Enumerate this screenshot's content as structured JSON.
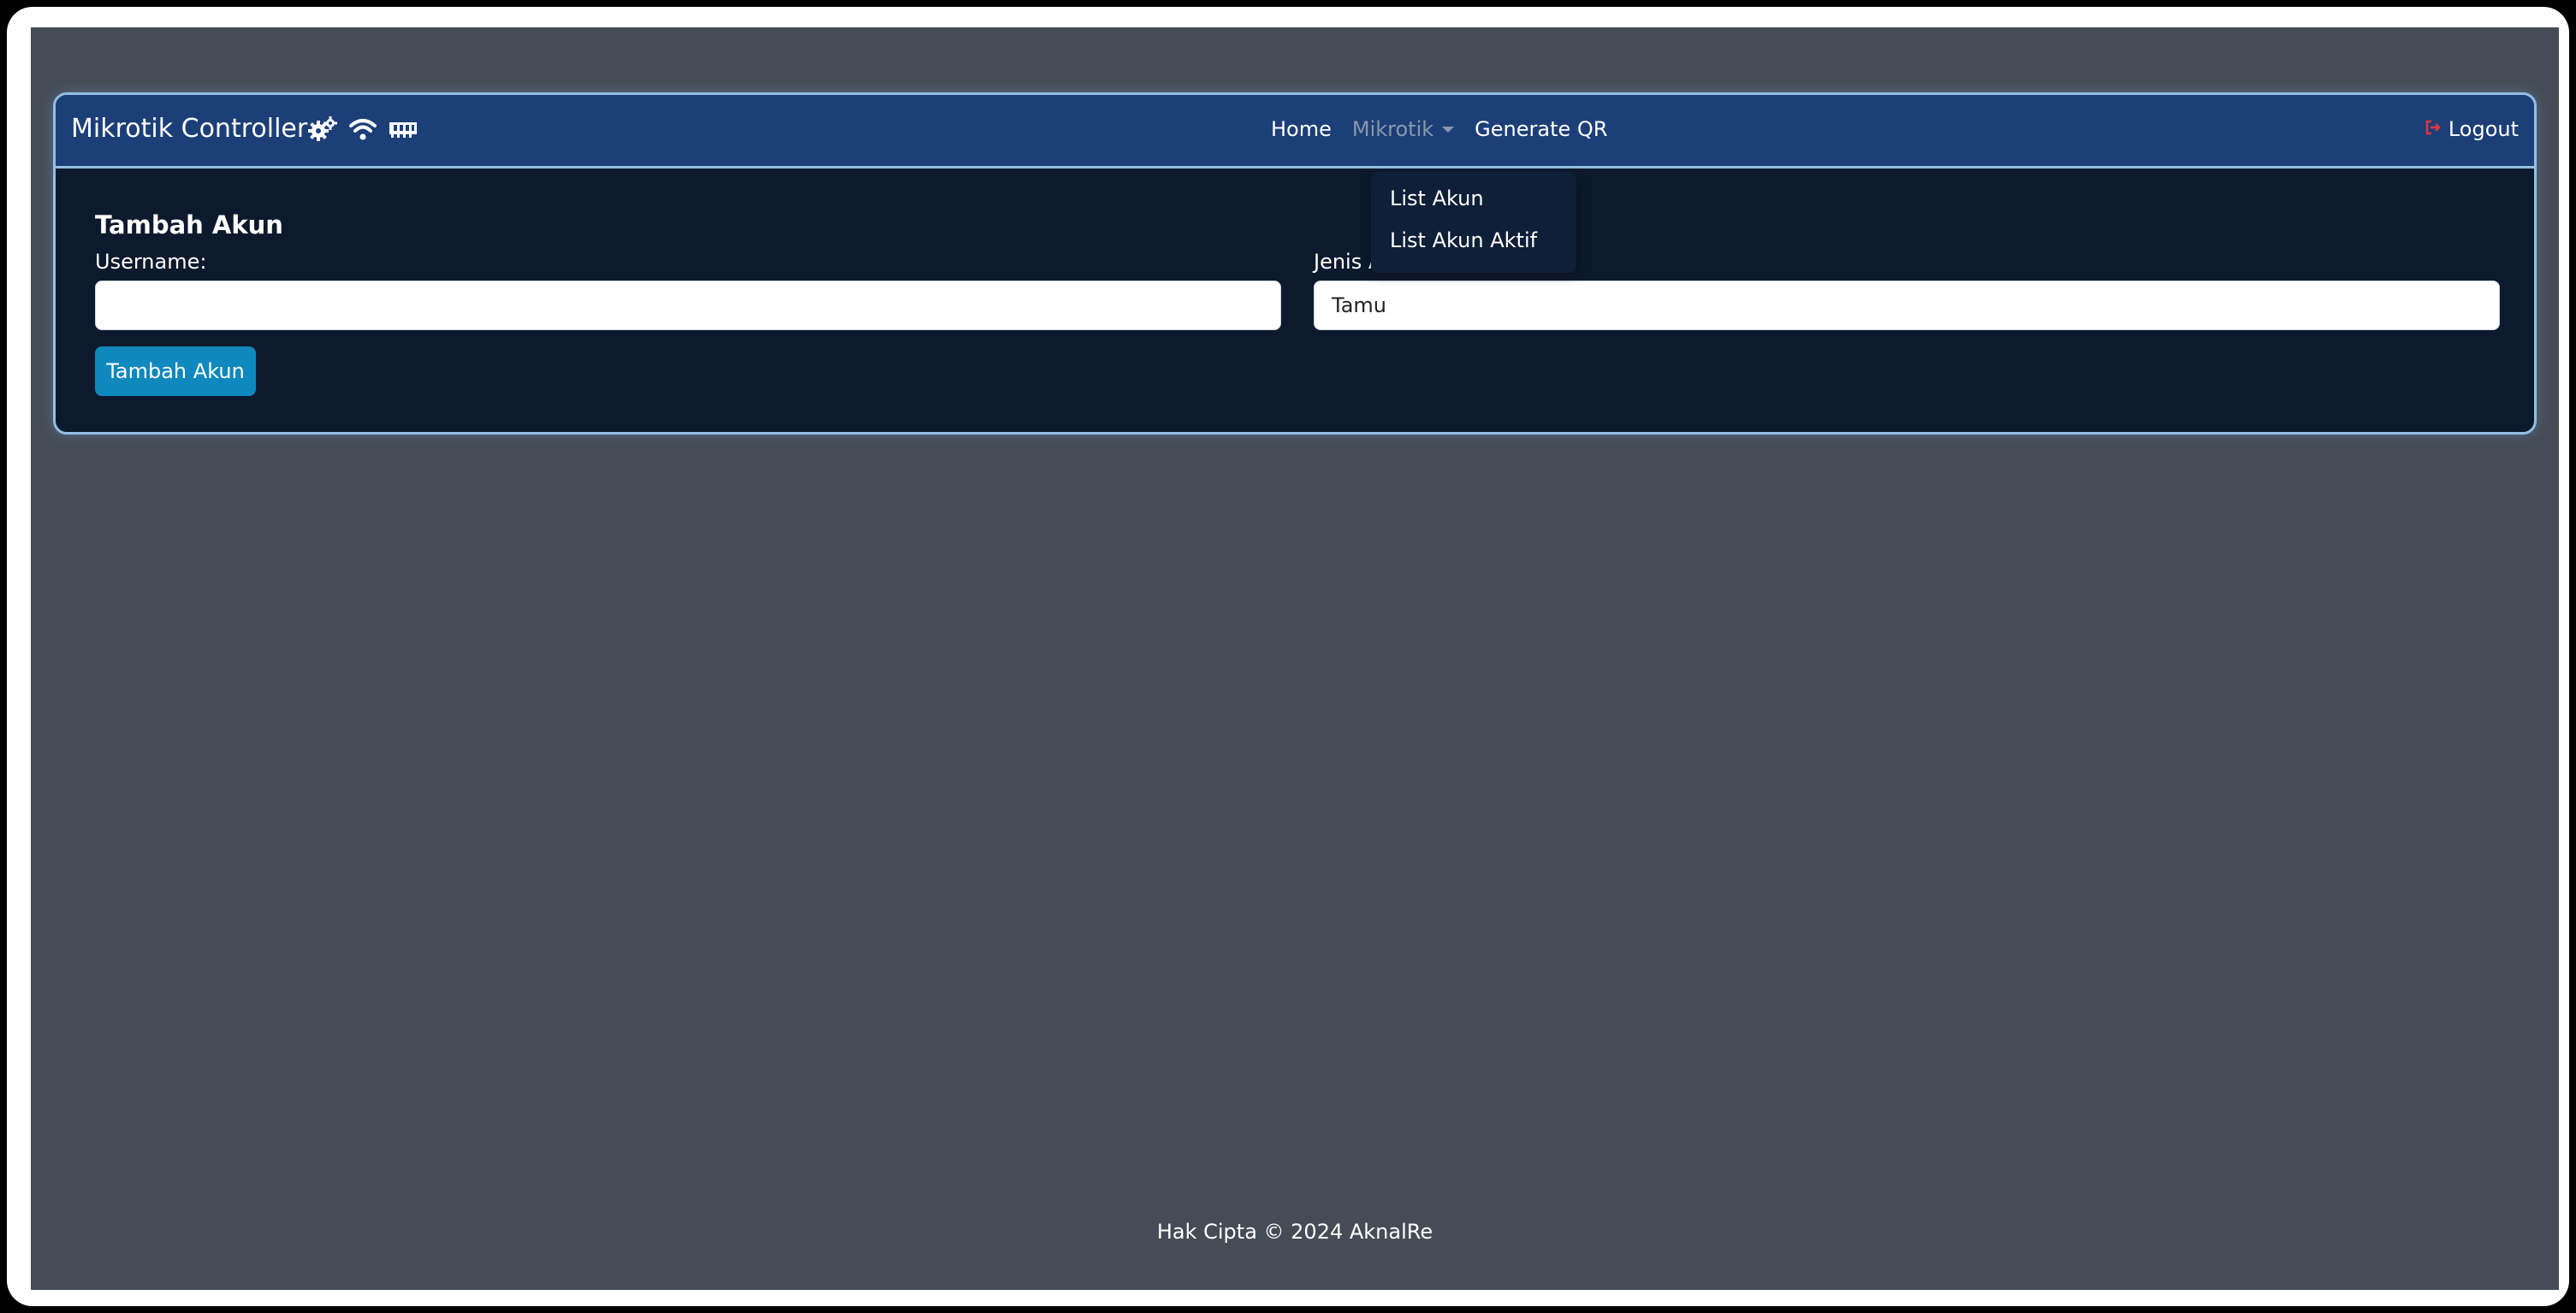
{
  "brand": {
    "title": "Mikrotik Controller",
    "icons": [
      "cogs-icon",
      "wifi-icon",
      "memory-icon"
    ]
  },
  "nav": {
    "home": "Home",
    "mikrotik": "Mikrotik",
    "generate_qr": "Generate QR",
    "logout": "Logout"
  },
  "dropdown": {
    "items": [
      {
        "label": "List Akun"
      },
      {
        "label": "List Akun Aktif"
      }
    ]
  },
  "form": {
    "title": "Tambah Akun",
    "username_label": "Username:",
    "username_value": "",
    "jenis_label": "Jenis Akun:",
    "jenis_value": "Tamu",
    "submit_label": "Tambah Akun"
  },
  "footer": {
    "text": "Hak Cipta © 2024 AknalRe"
  },
  "colors": {
    "navbar": "#1c3f78",
    "card": "#0d1a2d",
    "page": "#454c56",
    "button": "#0f88bd",
    "logout_icon": "#e0353f"
  }
}
